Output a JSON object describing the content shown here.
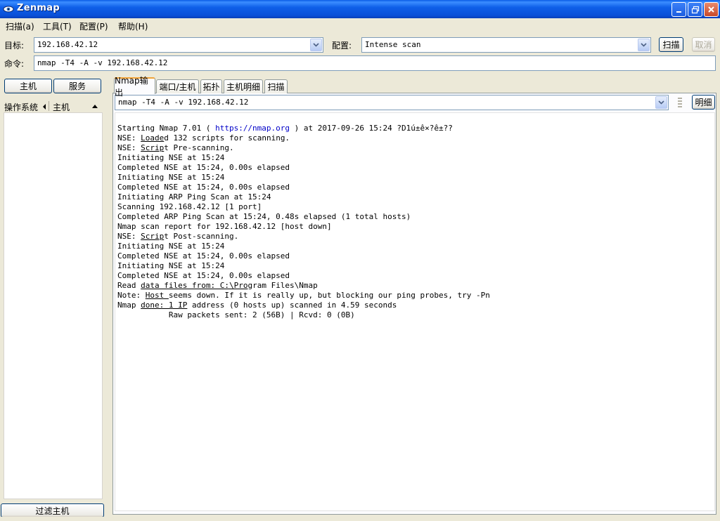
{
  "window": {
    "title": "Zenmap"
  },
  "menu": [
    {
      "label": "扫描(a)"
    },
    {
      "label": "工具(T)"
    },
    {
      "label": "配置(P)"
    },
    {
      "label": "帮助(H)"
    }
  ],
  "toolbar": {
    "target_label": "目标:",
    "target_value": "192.168.42.12",
    "profile_label": "配置:",
    "profile_value": "Intense scan",
    "scan_button": "扫描",
    "cancel_button": "取消",
    "command_label": "命令:",
    "command_value": "nmap -T4 -A -v 192.168.42.12"
  },
  "left_panel": {
    "hosts_button": "主机",
    "services_button": "服务",
    "col_os": "操作系统",
    "col_host": "主机",
    "filter_button": "过滤主机"
  },
  "tabs": [
    {
      "label": "Nmap输出",
      "active": true
    },
    {
      "label": "端口/主机"
    },
    {
      "label": "拓扑"
    },
    {
      "label": "主机明细"
    },
    {
      "label": "扫描"
    }
  ],
  "output_panel": {
    "command_select": "nmap -T4 -A -v 192.168.42.12",
    "details_button": "明细"
  },
  "output": {
    "line1_a": "Starting Nmap 7.01 ( ",
    "line1_link": "https://nmap.org",
    "line1_b": " ) at 2017-09-26 15:24 ?D1ú±ê×?ê±??",
    "line2_a": "NSE: ",
    "line2_u": "Loade",
    "line2_b": "d 132 scripts for scanning.",
    "line3_a": "NSE: ",
    "line3_u": "Scrip",
    "line3_b": "t Pre-scanning.",
    "line4": "Initiating NSE at 15:24",
    "line5": "Completed NSE at 15:24, 0.00s elapsed",
    "line6": "Initiating NSE at 15:24",
    "line7": "Completed NSE at 15:24, 0.00s elapsed",
    "line8": "Initiating ARP Ping Scan at 15:24",
    "line9": "Scanning 192.168.42.12 [1 port]",
    "line10": "Completed ARP Ping Scan at 15:24, 0.48s elapsed (1 total hosts)",
    "line11": "Nmap scan report for 192.168.42.12 [host down]",
    "line12_a": "NSE: ",
    "line12_u": "Scrip",
    "line12_b": "t Post-scanning.",
    "line13": "Initiating NSE at 15:24",
    "line14": "Completed NSE at 15:24, 0.00s elapsed",
    "line15": "Initiating NSE at 15:24",
    "line16": "Completed NSE at 15:24, 0.00s elapsed",
    "line17_a": "Read ",
    "line17_u": "data files from: C:\\Pro",
    "line17_b": "gram Files\\Nmap",
    "line18_a": "Note: ",
    "line18_u": "Host ",
    "line18_b": "seems down. If it is really up, but blocking our ping probes, try -Pn",
    "line19_a": "Nmap ",
    "line19_u": "done: 1 IP",
    "line19_b": " address (0 hosts up) scanned in 4.59 seconds",
    "line20": "           Raw packets sent: 2 (56B) | Rcvd: 0 (0B)"
  },
  "colors": {
    "titlebar": "#0a5ce6",
    "face": "#ece9d8",
    "link": "#0000c8",
    "active_tab_accent": "#f1a43a"
  }
}
